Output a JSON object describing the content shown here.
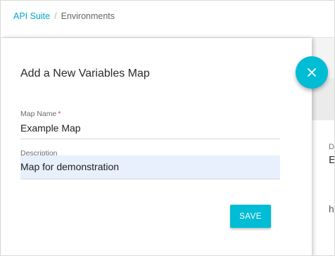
{
  "breadcrumb": {
    "root": "API Suite",
    "separator": "/",
    "current": "Environments"
  },
  "dialog": {
    "title": "Add a New Variables Map",
    "map_name": {
      "label": "Map Name",
      "required_mark": "*",
      "value": "Example Map"
    },
    "description": {
      "label": "Description",
      "value": "Map for demonstration"
    },
    "save_label": "SAVE",
    "close_icon": "close-icon"
  },
  "background": {
    "partial_label": "D",
    "partial_value": "E",
    "partial_text": "h"
  },
  "colors": {
    "accent": "#00bcd4",
    "link": "#00a7c8",
    "required": "#e53935",
    "autofill_bg": "#e8f0fe"
  }
}
